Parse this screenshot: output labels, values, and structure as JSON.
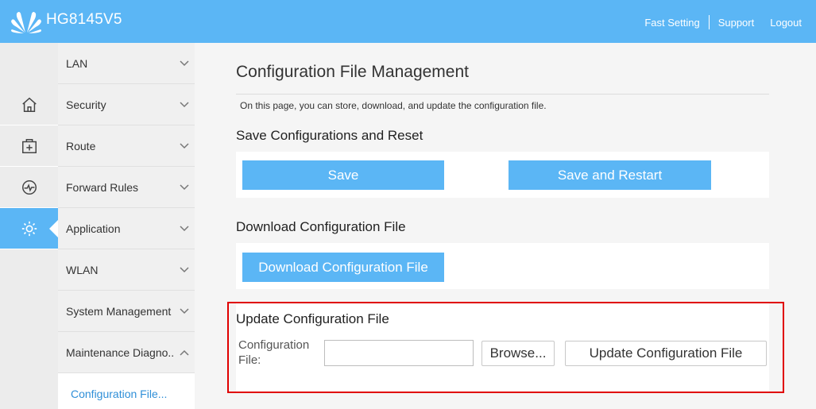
{
  "header": {
    "brand": "HG8145V5",
    "links": {
      "fast_setting": "Fast Setting",
      "support": "Support",
      "logout": "Logout"
    },
    "colors": {
      "bar": "#5bb6f5"
    }
  },
  "rail": {
    "icons": [
      "home-icon",
      "add-box-icon",
      "diagnose-icon",
      "gear-icon"
    ],
    "active": "gear-icon"
  },
  "menu": {
    "items": [
      {
        "label": "LAN"
      },
      {
        "label": "Security"
      },
      {
        "label": "Route"
      },
      {
        "label": "Forward Rules"
      },
      {
        "label": "Application"
      },
      {
        "label": "WLAN"
      },
      {
        "label": "System Management"
      },
      {
        "label": "Maintenance Diagno.."
      }
    ],
    "submenu": {
      "label": "Configuration File..."
    }
  },
  "main": {
    "title": "Configuration File Management",
    "description": "On this page, you can store, download, and update the configuration file.",
    "save_section": {
      "title": "Save Configurations and Reset",
      "save_label": "Save",
      "save_restart_label": "Save and Restart"
    },
    "download_section": {
      "title": "Download Configuration File",
      "download_label": "Download Configuration File"
    },
    "update_section": {
      "title": "Update Configuration File",
      "field_label_1": "Configuration",
      "field_label_2": "File:",
      "file_value": "",
      "browse_label": "Browse...",
      "update_label": "Update Configuration File"
    }
  }
}
